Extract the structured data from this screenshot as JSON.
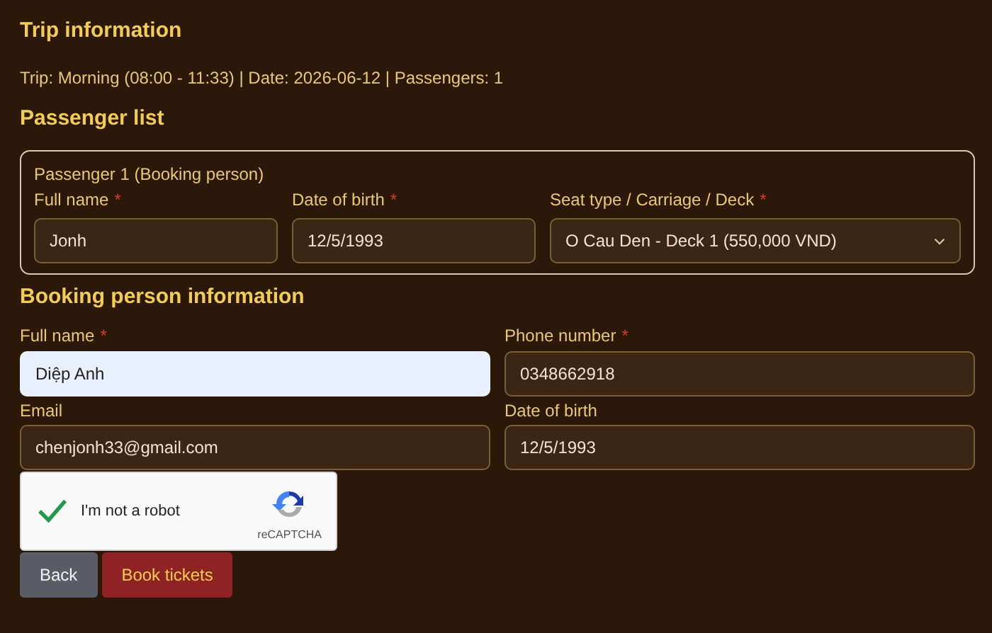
{
  "trip": {
    "heading": "Trip information",
    "summary": "Trip: Morning (08:00 - 11:33) | Date: 2026-06-12 | Passengers: 1"
  },
  "passenger_list": {
    "heading": "Passenger list",
    "passengers": [
      {
        "title": "Passenger 1 (Booking person)",
        "fields": [
          {
            "label": "Full name",
            "required_mark": "*",
            "kind": "input",
            "value": "Jonh",
            "highlighted": false
          },
          {
            "label": "Date of birth",
            "required_mark": "*",
            "kind": "input",
            "value": "12/5/1993",
            "highlighted": false
          },
          {
            "label": "Seat type / Carriage / Deck",
            "required_mark": "*",
            "kind": "select",
            "value": "O Cau Den - Deck 1 (550,000 VND)",
            "highlighted": false
          }
        ]
      }
    ]
  },
  "booking_person": {
    "heading": "Booking person information",
    "fields": [
      {
        "label": "Full name",
        "required_mark": "*",
        "kind": "input",
        "value": "Diệp Anh",
        "highlighted": true
      },
      {
        "label": "Phone number",
        "required_mark": "*",
        "kind": "input",
        "value": "0348662918",
        "highlighted": false
      },
      {
        "label": "Email",
        "kind": "input",
        "value": "chenjonh33@gmail.com",
        "highlighted": false
      },
      {
        "label": "Date of birth",
        "kind": "input",
        "value": "12/5/1993",
        "highlighted": false
      }
    ]
  },
  "captcha": {
    "label": "I'm not a robot",
    "checked": true,
    "brand": "reCAPTCHA"
  },
  "buttons": [
    {
      "label": "Back",
      "kind": "secondary"
    },
    {
      "label": "Book tickets",
      "kind": "primary"
    }
  ]
}
